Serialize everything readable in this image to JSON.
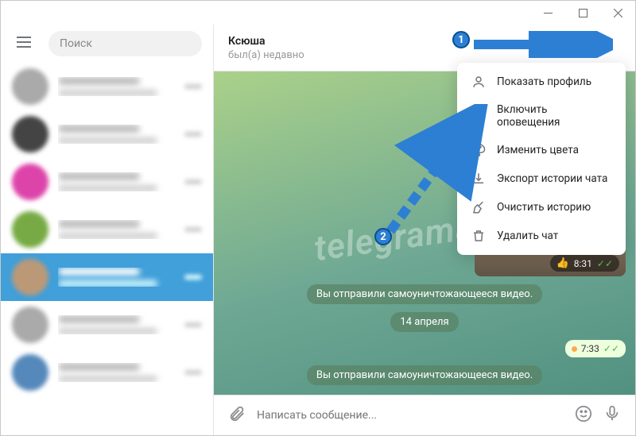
{
  "titlebar": {
    "minimize": "—",
    "maximize": "□",
    "close": "×"
  },
  "sidebar": {
    "search_placeholder": "Поиск",
    "chats": [
      {
        "active": false
      },
      {
        "active": false
      },
      {
        "active": false
      },
      {
        "active": false
      },
      {
        "active": true
      },
      {
        "active": false
      },
      {
        "active": false
      }
    ]
  },
  "chat": {
    "name": "Ксюша",
    "status": "был(а) недавно",
    "image_bubble": {
      "time": "8:31",
      "reaction": "👍"
    },
    "service1": "Вы отправили самоуничтожающееся видео.",
    "date_sep": "14 апреля",
    "small_time": "7:33",
    "service2": "Вы отправили самоуничтожающееся видео."
  },
  "compose": {
    "placeholder": "Написать сообщение..."
  },
  "menu": {
    "items": [
      {
        "label": "Показать профиль",
        "icon": "user"
      },
      {
        "label": "Включить оповещения",
        "icon": "sound"
      },
      {
        "label": "Изменить цвета",
        "icon": "palette"
      },
      {
        "label": "Экспорт истории чата",
        "icon": "export"
      },
      {
        "label": "Очистить историю",
        "icon": "broom"
      },
      {
        "label": "Удалить чат",
        "icon": "trash"
      }
    ]
  },
  "annotations": {
    "badge1": "1",
    "badge2": "2"
  },
  "watermark": "telegramas.ru"
}
